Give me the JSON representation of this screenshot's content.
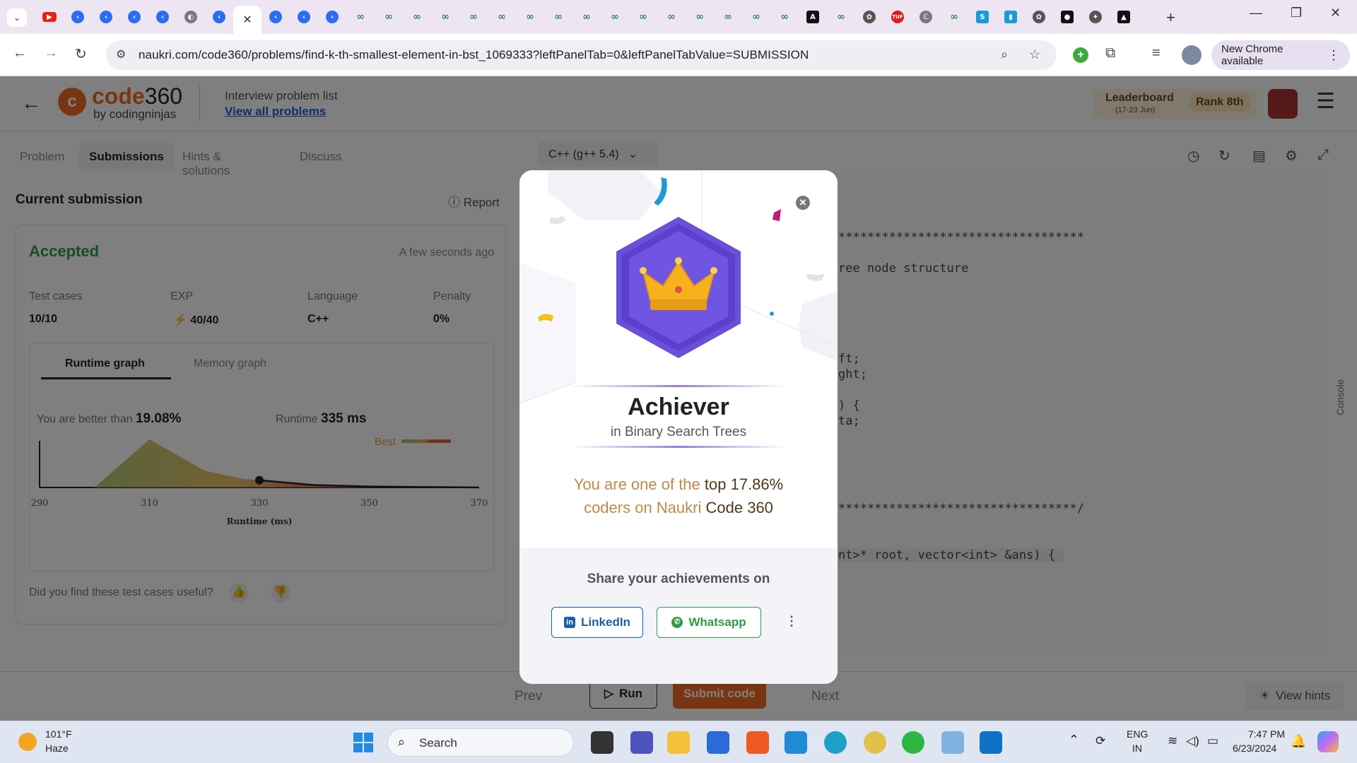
{
  "browser": {
    "url": "naukri.com/code360/problems/find-k-th-smallest-element-in-bst_1069333?leftPanelTab=0&leftPanelTabValue=SUBMISSION",
    "new_chrome_label": "New Chrome available"
  },
  "header": {
    "logo_main": "code",
    "logo_num": "360",
    "logo_sub": "by codingninjas",
    "problem_list_label": "Interview problem list",
    "view_all_link": "View all problems",
    "leaderboard_title": "Leaderboard",
    "leaderboard_dates": "(17-23 Jun)",
    "rank_label": "Rank 8th"
  },
  "tabs": {
    "problem": "Problem",
    "submissions": "Submissions",
    "hints": "Hints & solutions",
    "discuss": "Discuss"
  },
  "language_select": "C++ (g++ 5.4)",
  "submission": {
    "heading": "Current submission",
    "report": "Report",
    "status": "Accepted",
    "time_ago": "A few seconds ago",
    "test_cases_label": "Test cases",
    "test_cases_value": "10/10",
    "exp_label": "EXP",
    "exp_value": "40/40",
    "language_label": "Language",
    "language_value": "C++",
    "penalty_label": "Penalty",
    "penalty_value": "0%",
    "runtime_tab": "Runtime graph",
    "memory_tab": "Memory graph",
    "better_label": "You are better than",
    "better_value": "19.08%",
    "runtime_label": "Runtime",
    "runtime_value": "335 ms",
    "useful_question": "Did you find these test cases useful?"
  },
  "chart_data": {
    "type": "area",
    "xlabel": "Runtime (ms)",
    "x_ticks": [
      290,
      310,
      330,
      350,
      370
    ],
    "xlim": [
      290,
      370
    ],
    "legend": "Best",
    "curve_x": [
      290,
      300,
      310,
      320,
      327,
      330,
      340,
      350,
      360,
      370
    ],
    "curve_y": [
      0,
      0,
      1.0,
      0.35,
      0.18,
      0.15,
      0.05,
      0.02,
      0.01,
      0
    ],
    "marker_x": 330
  },
  "code_lines": [
    "**********************************",
    "ree node structure",
    "ft;",
    "ght;",
    ") {",
    "ta;",
    "*********************************/",
    "nt>* root, vector<int> &ans) {"
  ],
  "console_label": "Console",
  "bottom": {
    "prev": "Prev",
    "run": "Run",
    "submit": "Submit code",
    "next": "Next",
    "view_hints": "View hints"
  },
  "modal": {
    "title": "Achiever",
    "subtitle": "in Binary Search Trees",
    "msg_prefix": "You are one of the",
    "msg_highlight": "top 17.86%",
    "msg_coders": "coders on Naukri",
    "msg_brand": "Code 360",
    "share_title": "Share your achievements on",
    "linkedin": "LinkedIn",
    "whatsapp": "Whatsapp"
  },
  "taskbar": {
    "temp": "101°F",
    "weather": "Haze",
    "search": "Search",
    "lang1": "ENG",
    "lang2": "IN",
    "time": "7:47 PM",
    "date": "6/23/2024"
  }
}
